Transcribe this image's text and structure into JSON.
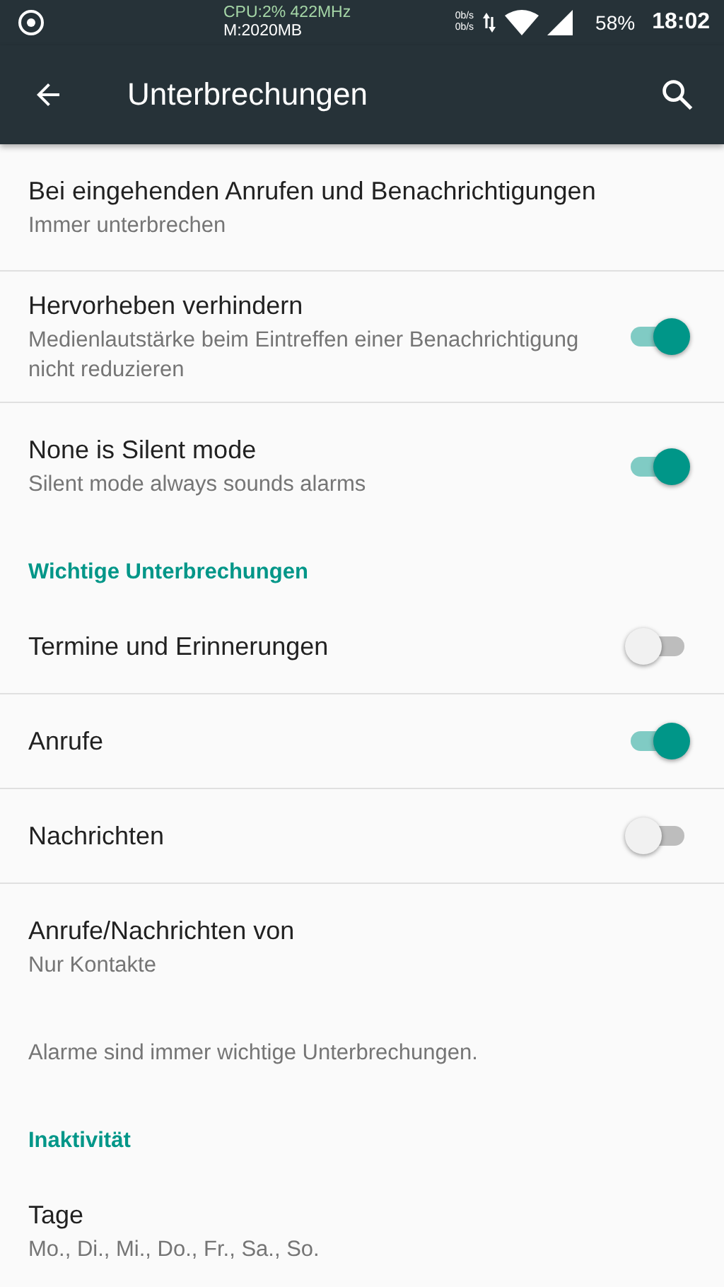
{
  "status_bar": {
    "cpu": "CPU:2% 422MHz",
    "memory": "M:2020MB",
    "net_up": "0b/s",
    "net_down": "0b/s",
    "battery": "58%",
    "time": "18:02"
  },
  "toolbar": {
    "title": "Unterbrechungen"
  },
  "items": [
    {
      "kind": "setting",
      "title": "Bei eingehenden Anrufen und Benachrichtigungen",
      "summary": "Immer unterbrechen"
    },
    {
      "kind": "switch",
      "title": "Hervorheben verhindern",
      "summary": "Medienlautstärke beim Eintreffen einer Benachrichtigung nicht reduzieren",
      "on": true
    },
    {
      "kind": "switch",
      "title": "None is Silent mode",
      "summary": "Silent mode always sounds alarms",
      "on": true
    },
    {
      "kind": "header",
      "title": "Wichtige Unterbrechungen"
    },
    {
      "kind": "switch",
      "title": "Termine und Erinnerungen",
      "on": false
    },
    {
      "kind": "switch",
      "title": "Anrufe",
      "on": true
    },
    {
      "kind": "switch",
      "title": "Nachrichten",
      "on": false
    },
    {
      "kind": "setting",
      "title": "Anrufe/Nachrichten von",
      "summary": "Nur Kontakte"
    },
    {
      "kind": "note",
      "title": "Alarme sind immer wichtige Unterbrechungen."
    },
    {
      "kind": "header",
      "title": "Inaktivität"
    },
    {
      "kind": "setting",
      "title": "Tage",
      "summary": "Mo., Di., Mi., Do., Fr., Sa., So."
    }
  ]
}
